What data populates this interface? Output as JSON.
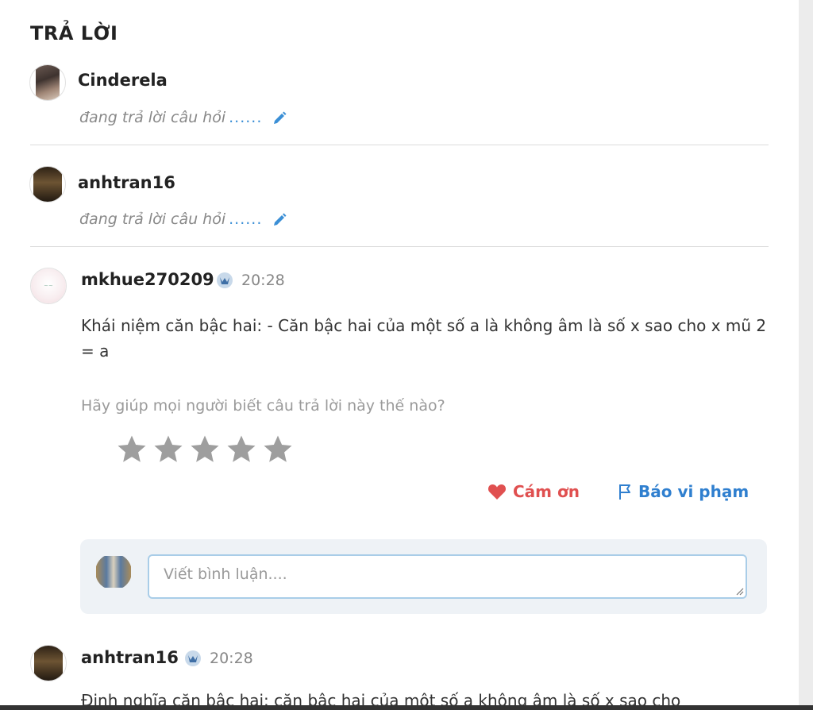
{
  "section": {
    "title": "TRẢ LỜI"
  },
  "typing_users": [
    {
      "username": "Cinderela",
      "status_text": "đang trả lời câu hỏi",
      "dots": "......"
    },
    {
      "username": "anhtran16",
      "status_text": "đang trả lời câu hỏi",
      "dots": "......"
    }
  ],
  "answers": [
    {
      "username": "mkhue270209",
      "time": "20:28",
      "text": "Khái niệm căn bậc hai: - Căn bậc hai của một số a là không âm là số x sao cho x mũ 2 = a",
      "rating_prompt": "Hãy giúp mọi người biết câu trả lời này thế nào?",
      "rating": 0,
      "max_rating": 5,
      "thanks_label": "Cám ơn",
      "report_label": "Báo vi phạm"
    },
    {
      "username": "anhtran16",
      "time": "20:28",
      "text": "Định nghĩa căn bậc hai: căn bậc hai của một số a không âm là số x sao cho"
    }
  ],
  "comment": {
    "placeholder": "Viết bình luận...."
  },
  "colors": {
    "accent_blue": "#2f7fcf",
    "thanks_red": "#e05050",
    "star_gray": "#9e9e9e"
  }
}
